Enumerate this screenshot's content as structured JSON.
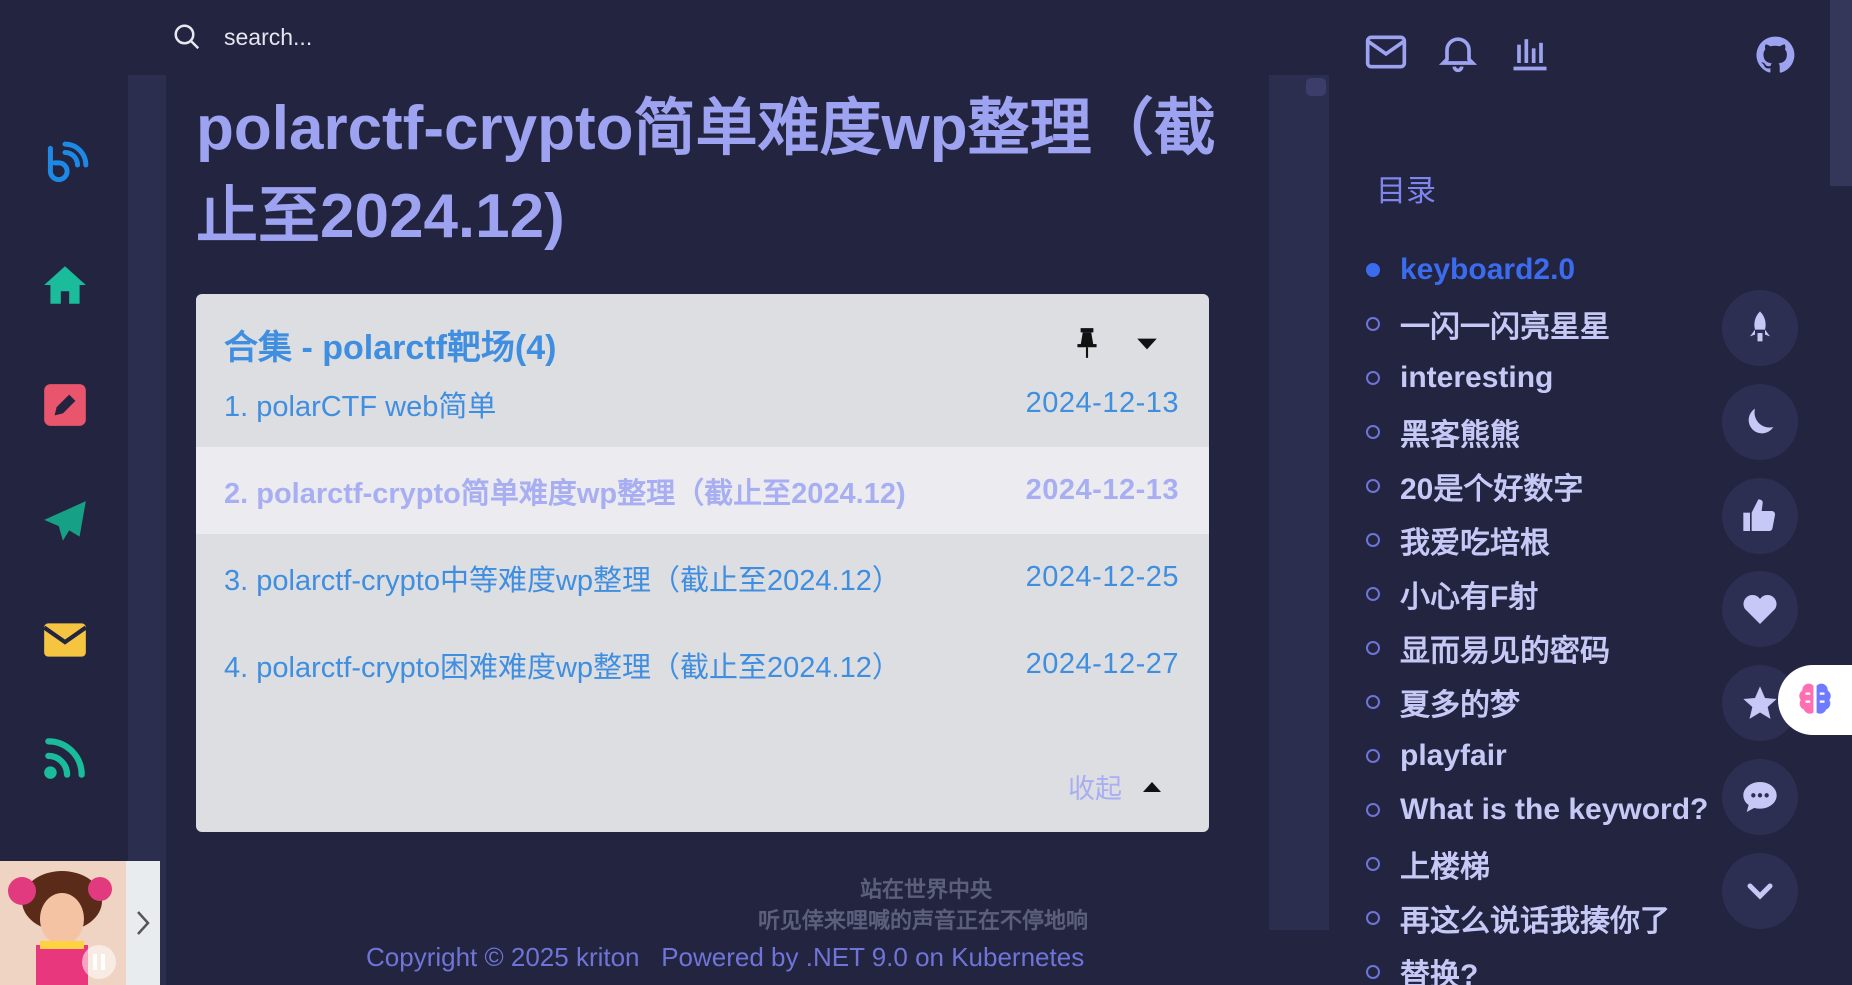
{
  "search": {
    "placeholder": "search..."
  },
  "page": {
    "title": "polarctf-crypto简单难度wp整理（截止至2024.12)"
  },
  "collection": {
    "title": "合集 - polarctf靶场(4)",
    "items": [
      {
        "label": "1. polarCTF web简单",
        "date": "2024-12-13"
      },
      {
        "label": "2. polarctf-crypto简单难度wp整理（截止至2024.12)",
        "date": "2024-12-13"
      },
      {
        "label": "3. polarctf-crypto中等难度wp整理（截止至2024.12）",
        "date": "2024-12-25"
      },
      {
        "label": "4. polarctf-crypto困难难度wp整理（截止至2024.12）",
        "date": "2024-12-27"
      }
    ],
    "collapse_label": "收起"
  },
  "lyrics": {
    "line1": "站在世界中央",
    "line2": "听见倖来哩喊的声音正在不停地响"
  },
  "footer": {
    "copyright": "Copyright © 2025 kriton",
    "powered": "Powered by .NET 9.0 on Kubernetes"
  },
  "toc": {
    "header": "目录",
    "items": [
      "keyboard2.0",
      "一闪一闪亮星星",
      "interesting",
      "黑客熊熊",
      "20是个好数字",
      "我爱吃培根",
      "小心有F射",
      "显而易见的密码",
      "夏多的梦",
      "playfair",
      "What is the keyword?",
      "上楼梯",
      "再这么说话我揍你了",
      "替换?"
    ],
    "active_index": 0
  },
  "colors": {
    "background": "#23243f",
    "title": "#9da3f0",
    "link": "#3f8ee0",
    "toc_active": "#3b6cf0",
    "side_blue": "#1e88e5",
    "side_teal": "#1abc9c",
    "side_red": "#e8556d",
    "side_green": "#16a085",
    "side_yellow": "#f5c542"
  },
  "icons": {
    "top": [
      "mail-icon",
      "bell-icon",
      "chart-icon",
      "github-icon"
    ],
    "sidebar": [
      "blog-logo-icon",
      "home-icon",
      "edit-icon",
      "send-icon",
      "envelope-icon",
      "rss-icon"
    ],
    "fabs": [
      "rocket-icon",
      "moon-icon",
      "thumbs-up-icon",
      "heart-icon",
      "star-icon",
      "comment-icon",
      "chevron-down-icon"
    ]
  }
}
